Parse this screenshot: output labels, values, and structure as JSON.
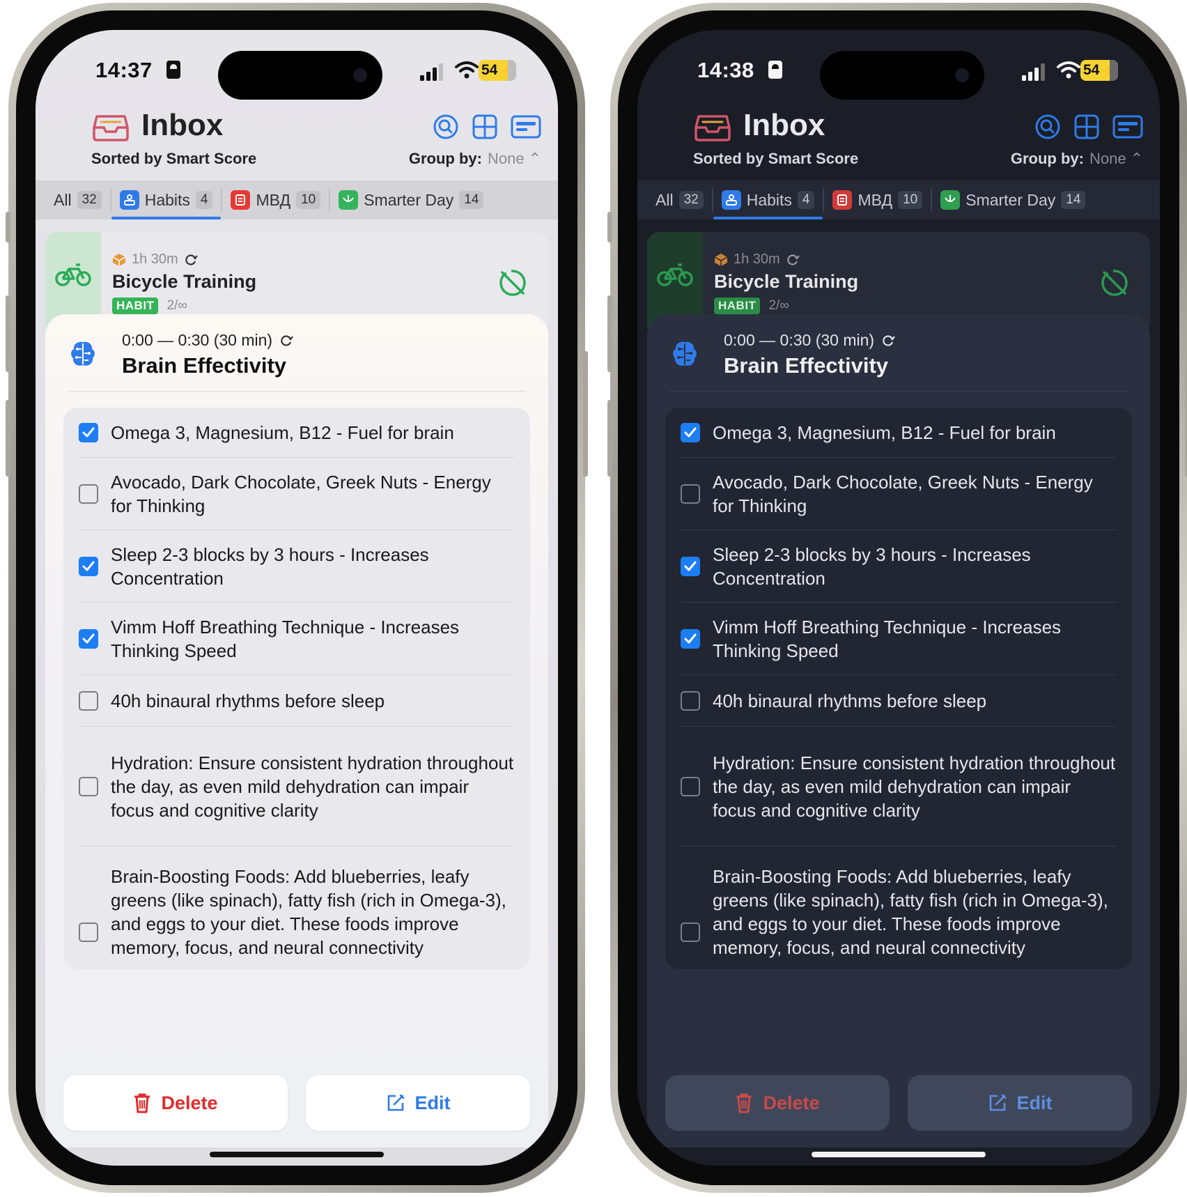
{
  "status": {
    "time_light": "14:37",
    "time_dark": "14:38",
    "battery": "54"
  },
  "header": {
    "title": "Inbox",
    "subtitle": "Sorted by Smart Score",
    "group_by_label": "Group by:",
    "group_by_value": "None"
  },
  "tabs": [
    {
      "label": "All",
      "count": "32"
    },
    {
      "label": "Habits",
      "count": "4"
    },
    {
      "label": "МВД",
      "count": "10"
    },
    {
      "label": "Smarter Day",
      "count": "14"
    }
  ],
  "bicycle_card": {
    "duration": "1h 30m",
    "title": "Bicycle Training",
    "tag": "HABIT",
    "progress": "2/∞"
  },
  "sheet": {
    "time_range": "0:00 — 0:30 (30 min)",
    "title": "Brain Effectivity",
    "items": [
      {
        "text": "Omega 3, Magnesium, B12 - Fuel for brain",
        "checked": true
      },
      {
        "text": "Avocado, Dark Chocolate, Greek Nuts - Energy for Thinking",
        "checked": false
      },
      {
        "text": "Sleep 2-3 blocks by 3 hours - Increases Concentration",
        "checked": true
      },
      {
        "text": "Vimm Hoff Breathing Technique - Increases Thinking Speed",
        "checked": true
      },
      {
        "text": "40h binaural rhythms before sleep",
        "checked": false
      },
      {
        "text": "Hydration: Ensure consistent hydration throughout the day, as even mild dehydration can impair focus and cognitive clarity",
        "checked": false
      },
      {
        "text": "Brain-Boosting Foods: Add blueberries, leafy greens (like spinach), fatty fish (rich in Omega-3), and eggs to your diet. These foods improve memory, focus, and neural connectivity",
        "checked": false
      }
    ],
    "delete_label": "Delete",
    "edit_label": "Edit"
  },
  "colors": {
    "accent_blue": "#2f7bea",
    "check_blue": "#1c7ef2",
    "delete_red": "#e02b2b",
    "habit_green": "#35b458",
    "battery_yellow": "#f6d333"
  },
  "icons": [
    "inbox-tray-icon",
    "search-circle-icon",
    "grid-icon",
    "card-view-icon",
    "habits-icon",
    "mvd-icon",
    "smarter-day-icon",
    "bicycle-icon",
    "box-icon",
    "repeat-icon",
    "skip-icon",
    "brain-icon",
    "trash-icon",
    "edit-icon"
  ]
}
